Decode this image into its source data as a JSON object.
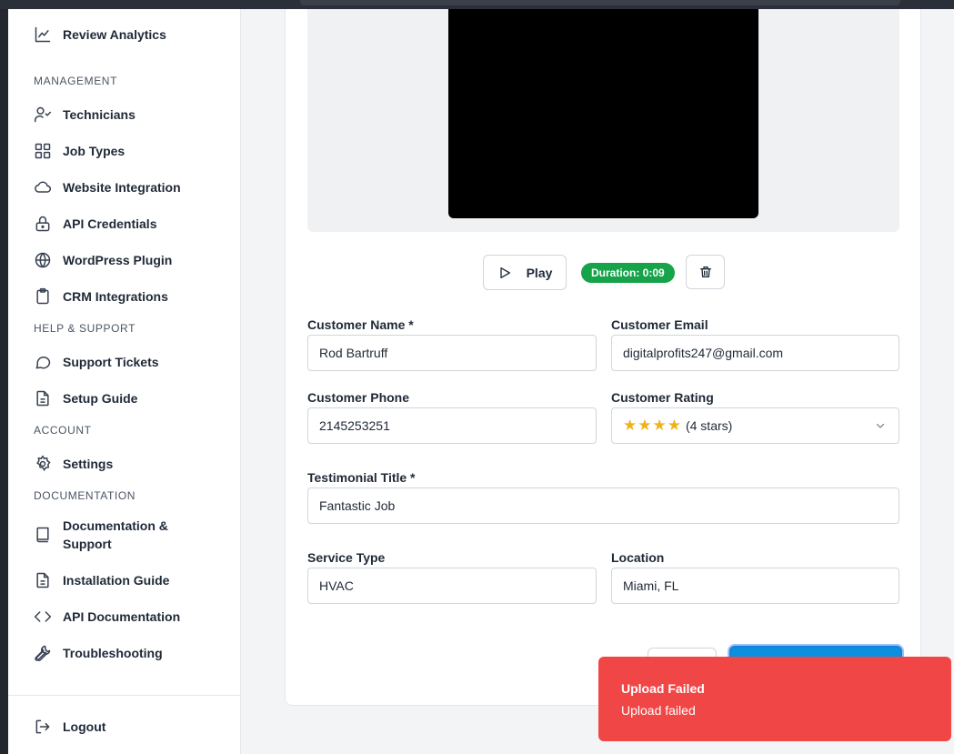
{
  "sidebar": {
    "top_item": {
      "label": "Review Analytics",
      "icon": "chart-line-icon"
    },
    "sections": {
      "management": "MANAGEMENT",
      "help": "HELP & SUPPORT",
      "account": "ACCOUNT",
      "documentation": "DOCUMENTATION"
    },
    "items": [
      {
        "label": "Technicians",
        "icon": "users-icon"
      },
      {
        "label": "Job Types",
        "icon": "grid-icon"
      },
      {
        "label": "Website Integration",
        "icon": "cloud-icon"
      },
      {
        "label": "API Credentials",
        "icon": "lock-icon"
      },
      {
        "label": "WordPress Plugin",
        "icon": "globe-icon"
      },
      {
        "label": "CRM Integrations",
        "icon": "clipboard-icon"
      },
      {
        "label": "Support Tickets",
        "icon": "chat-bubble-icon"
      },
      {
        "label": "Setup Guide",
        "icon": "document-icon"
      },
      {
        "label": "Settings",
        "icon": "gear-icon"
      },
      {
        "label": "Documentation & Support",
        "icon": "book-icon"
      },
      {
        "label": "Installation Guide",
        "icon": "document-icon"
      },
      {
        "label": "API Documentation",
        "icon": "code-icon"
      },
      {
        "label": "Troubleshooting",
        "icon": "wrench-icon"
      }
    ],
    "logout": {
      "label": "Logout",
      "icon": "logout-icon"
    }
  },
  "video": {
    "play_label": "Play",
    "duration_badge": "Duration: 0:09",
    "delete_icon": "trash-icon"
  },
  "form": {
    "customer_name": {
      "label": "Customer Name *",
      "value": "Rod Bartruff"
    },
    "customer_email": {
      "label": "Customer Email",
      "value": "digitalprofits247@gmail.com"
    },
    "customer_phone": {
      "label": "Customer Phone",
      "value": "2145253251"
    },
    "customer_rating": {
      "label": "Customer Rating",
      "stars": "★★★★",
      "text": "(4 stars)",
      "rating": 4
    },
    "testimonial_title": {
      "label": "Testimonial Title *",
      "value": "Fantastic Job"
    },
    "service_type": {
      "label": "Service Type",
      "value": "HVAC"
    },
    "location": {
      "label": "Location",
      "value": "Miami, FL"
    }
  },
  "toast": {
    "title": "Upload Failed",
    "message": "Upload failed"
  },
  "colors": {
    "toast_bg": "#f04646",
    "badge_bg": "#16a34a",
    "primary_button": "#0b8fe0",
    "star": "#f0b21a"
  }
}
